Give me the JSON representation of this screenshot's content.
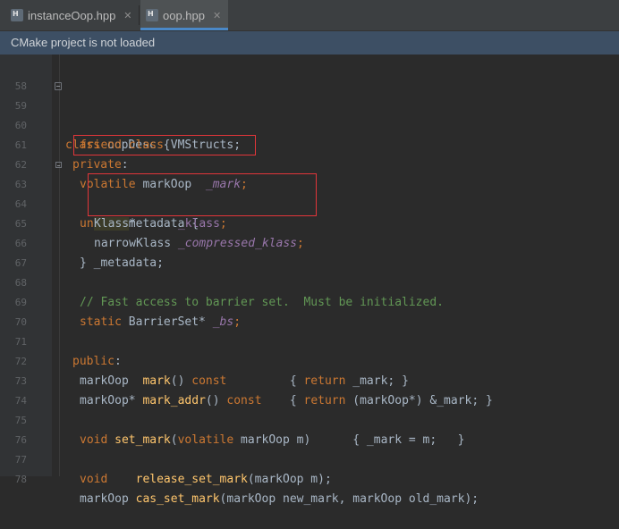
{
  "tabs": [
    {
      "label": "instanceOop.hpp",
      "icon": "h-file-icon",
      "active": false
    },
    {
      "label": "oop.hpp",
      "icon": "h-file-icon",
      "active": true
    }
  ],
  "banner": {
    "text": "CMake project is not loaded"
  },
  "lines": {
    "n58": "58",
    "n59": "59",
    "n60": "60",
    "n61": "61",
    "n62": "62",
    "n63": "63",
    "n64": "64",
    "n65": "65",
    "n66": "66",
    "n67": "67",
    "n68": "68",
    "n69": "69",
    "n70": "70",
    "n71": "71",
    "n72": "72",
    "n73": "73",
    "n74": "74",
    "n75": "75",
    "n76": "76",
    "n77": "77",
    "n78": "78"
  },
  "code": {
    "l59": {
      "kw": "class",
      "name": " oopDesc {"
    },
    "l60": {
      "kw": "friend class",
      "name": " VMStructs;"
    },
    "l61": {
      "kw": "private",
      "rest": ":"
    },
    "l62": {
      "kw": "volatile",
      "type": " markOop  ",
      "field": "_mark",
      "semi": ";"
    },
    "l63": {
      "kw": "union",
      "rest": " _metadata {"
    },
    "l64": {
      "type": "Klass",
      "rest": "*      ",
      "field": "_klass",
      "semi": ";"
    },
    "l65": {
      "type": "narrowKlass ",
      "field": "_compressed_klass",
      "semi": ";"
    },
    "l66": {
      "rest": "} _metadata;"
    },
    "l68": {
      "comment": "// Fast access to barrier set.  Must be initialized."
    },
    "l69": {
      "kw": "static",
      "type": " BarrierSet* ",
      "field": "_bs",
      "semi": ";"
    },
    "l71": {
      "kw": "public",
      "rest": ":"
    },
    "l72": {
      "a": "markOop  ",
      "fn": "mark",
      "b": "() ",
      "kw": "const",
      "c": "         { ",
      "kw2": "return",
      "d": " _mark; }"
    },
    "l73": {
      "a": "markOop* ",
      "fn": "mark_addr",
      "b": "() ",
      "kw": "const",
      "c": "    { ",
      "kw2": "return",
      "d": " (markOop*) &_mark; }"
    },
    "l75": {
      "kw": "void",
      "fn": " set_mark",
      "b": "(",
      "kw2": "volatile",
      "c": " markOop m)      { _mark = m;   }"
    },
    "l77": {
      "kw": "void",
      "sp": "    ",
      "fn": "release_set_mark",
      "b": "(markOop m);"
    },
    "l78": {
      "a": "markOop ",
      "fn": "cas_set_mark",
      "b": "(markOop new_mark, markOop old_mark);"
    }
  }
}
